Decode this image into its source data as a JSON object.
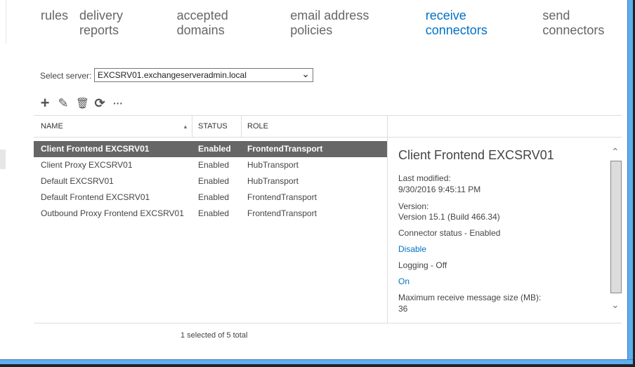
{
  "tabs": [
    {
      "label": "rules"
    },
    {
      "label": "delivery reports"
    },
    {
      "label": "accepted domains"
    },
    {
      "label": "email address policies"
    },
    {
      "label": "receive connectors",
      "active": true
    },
    {
      "label": "send connectors"
    }
  ],
  "server": {
    "label": "Select server:",
    "value": "EXCSRV01.exchangeserveradmin.local"
  },
  "toolbar": {
    "icons": [
      "add-icon",
      "edit-icon",
      "delete-icon",
      "refresh-icon",
      "more-icon"
    ]
  },
  "table": {
    "headers": {
      "name": "NAME",
      "status": "STATUS",
      "role": "ROLE"
    },
    "rows": [
      {
        "name": "Client Frontend EXCSRV01",
        "status": "Enabled",
        "role": "FrontendTransport",
        "selected": true
      },
      {
        "name": "Client Proxy EXCSRV01",
        "status": "Enabled",
        "role": "HubTransport"
      },
      {
        "name": "Default EXCSRV01",
        "status": "Enabled",
        "role": "HubTransport"
      },
      {
        "name": "Default Frontend EXCSRV01",
        "status": "Enabled",
        "role": "FrontendTransport"
      },
      {
        "name": "Outbound Proxy Frontend EXCSRV01",
        "status": "Enabled",
        "role": "FrontendTransport"
      }
    ]
  },
  "details": {
    "title": "Client Frontend EXCSRV01",
    "last_modified_label": "Last modified:",
    "last_modified": "9/30/2016 9:45:11 PM",
    "version_label": "Version:",
    "version": "Version 15.1 (Build 466.34)",
    "connector_status": "Connector status - Enabled",
    "disable_link": "Disable",
    "logging": "Logging - Off",
    "on_link": "On",
    "max_size_label": "Maximum receive message size (MB):",
    "max_size": "36"
  },
  "footer": {
    "count": "1 selected of 5 total"
  },
  "colors": {
    "accent": "#0072c6",
    "selected_row": "#666666",
    "window_border": "#5faef0"
  }
}
